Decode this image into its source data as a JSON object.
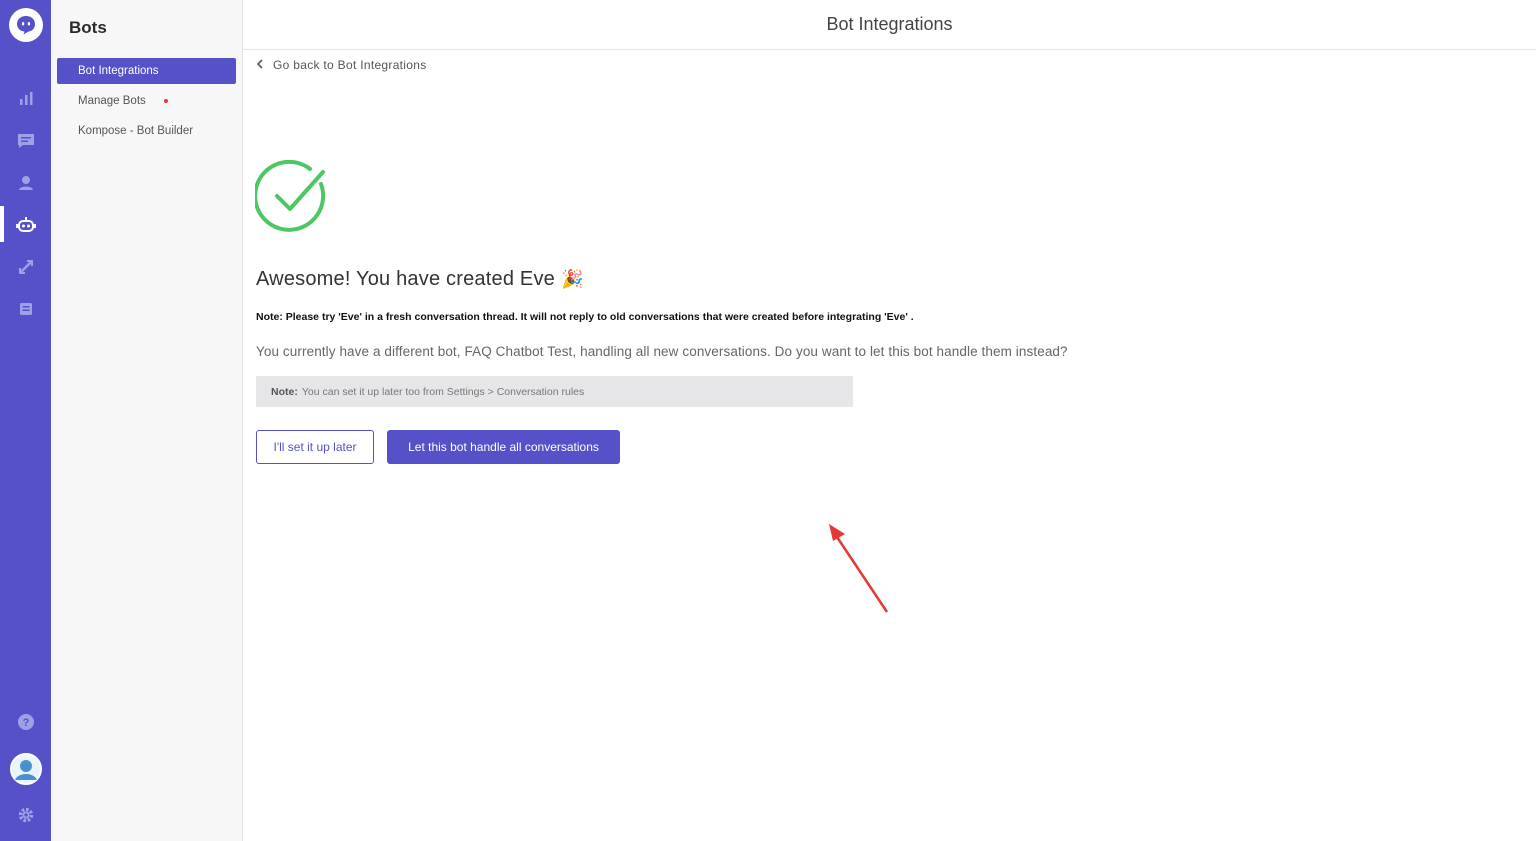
{
  "rail": {
    "icons": [
      "chat-logo-icon",
      "analytics-icon",
      "conversations-icon",
      "users-icon",
      "bot-icon",
      "integrations-icon",
      "inbox-icon",
      "help-icon",
      "user-avatar",
      "settings-icon"
    ]
  },
  "sidebar": {
    "title": "Bots",
    "items": [
      {
        "label": "Bot Integrations",
        "active": true
      },
      {
        "label": "Manage Bots",
        "has_dot": true
      },
      {
        "label": "Kompose - Bot Builder"
      }
    ]
  },
  "header": {
    "title": "Bot Integrations"
  },
  "main": {
    "back_link": "Go back to Bot Integrations",
    "heading": "Awesome! You have created Eve",
    "heading_emoji": "🎉",
    "note_bold": "Note: Please try 'Eve' in a fresh conversation thread. It will not reply to old conversations that were created before integrating 'Eve' .",
    "question": "You currently have a different bot, FAQ Chatbot Test, handling all new conversations. Do you want to let this bot handle them instead?",
    "grey_note_label": "Note:",
    "grey_note_text": "You can set it up later too from Settings > Conversation rules",
    "btn_later": "I'll set it up later",
    "btn_handle": "Let this bot handle all conversations"
  },
  "colors": {
    "brand": "#5451c9",
    "success": "#4cc764",
    "annotation_arrow": "#e53935"
  }
}
